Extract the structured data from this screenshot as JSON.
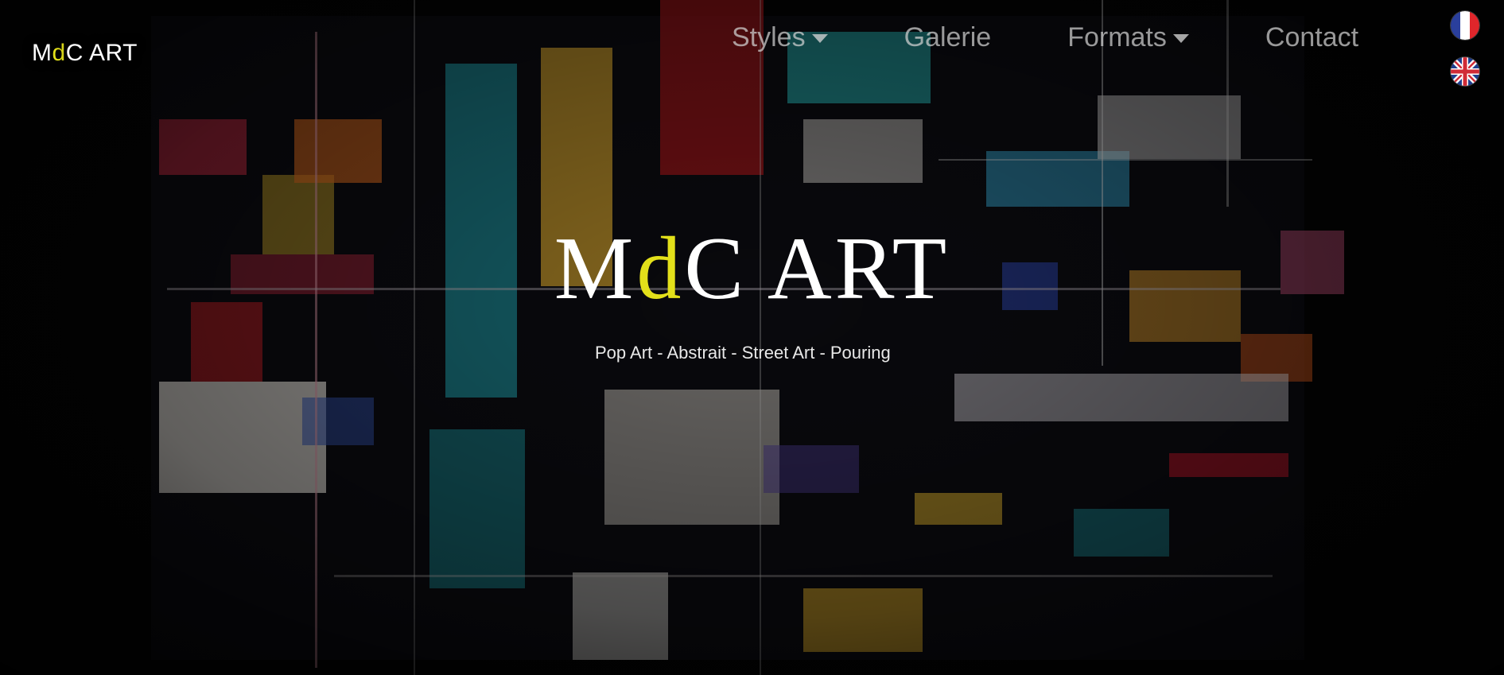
{
  "brand": {
    "prefix": "M",
    "accent": "d",
    "suffix": "C ART"
  },
  "nav": {
    "items": [
      {
        "label": "Styles",
        "has_dropdown": true
      },
      {
        "label": "Galerie",
        "has_dropdown": false
      },
      {
        "label": "Formats",
        "has_dropdown": true
      },
      {
        "label": "Contact",
        "has_dropdown": false
      }
    ]
  },
  "languages": [
    {
      "code": "fr",
      "icon": "france-flag-icon"
    },
    {
      "code": "en",
      "icon": "uk-flag-icon"
    }
  ],
  "hero": {
    "title_prefix": "M",
    "title_accent": "d",
    "title_suffix": "C ART",
    "subtitle": "Pop Art - Abstrait - Street Art - Pouring"
  },
  "colors": {
    "accent": "#e3e01a",
    "text": "#ffffff",
    "nav_text": "#d2d2d2",
    "background": "#000000"
  }
}
